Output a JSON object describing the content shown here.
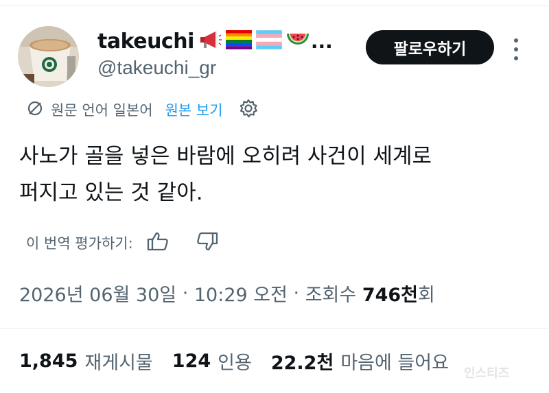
{
  "author": {
    "display_name": "takeuchi",
    "emoji_icons": [
      "megaphone-emoji",
      "rainbow-flag-emoji",
      "trans-flag-emoji",
      "watermelon-emoji"
    ],
    "name_ellipsis": "...",
    "handle": "@takeuchi_gr"
  },
  "follow_label": "팔로우하기",
  "translation": {
    "note": "원문 언어 일본어",
    "show_original": "원본 보기"
  },
  "tweet_text_line1": "사노가 골을 넣은 바람에 오히려 사건이 세계로",
  "tweet_text_line2": "퍼지고 있는 것 같아.",
  "rate_label": "이 번역 평가하기:",
  "meta": {
    "date": "2026년 06월 30일",
    "sep1": " · ",
    "time": "10:29 오전",
    "sep2": " · ",
    "views_label": "조회수 ",
    "views_value": "746천",
    "views_unit": "회"
  },
  "stats": {
    "retweets_value": "1,845",
    "retweets_label": "재게시물",
    "quotes_value": "124",
    "quotes_label": "인용",
    "likes_value": "22.2천",
    "likes_label": "마음에 들어요"
  },
  "watermark": "인스티즈",
  "colors": {
    "link": "#1d9bf0",
    "secondary_text": "#536471",
    "primary_text": "#0f1419",
    "button_bg": "#0f1419"
  }
}
